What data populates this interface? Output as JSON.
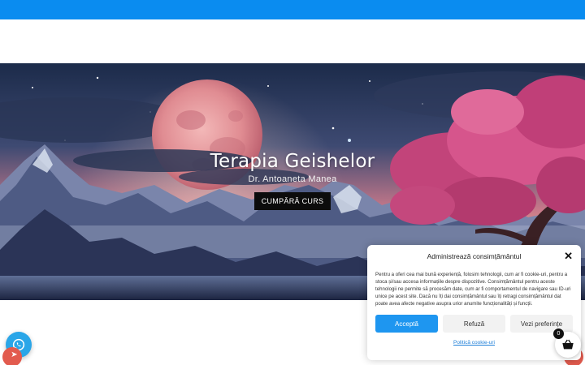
{
  "topbar": {
    "color": "#0a8cf0"
  },
  "hero": {
    "title": "Terapia Geishelor",
    "subtitle": "Dr. Antoaneta Manea",
    "button_label": "CUMPĂRĂ CURS"
  },
  "consent": {
    "title": "Administrează consimțământul",
    "body": "Pentru a oferi cea mai bună experiență, folosim tehnologii, cum ar fi cookie-uri, pentru a stoca și/sau accesa informațiile despre dispozitive. Consimțământul pentru aceste tehnologii ne permite să procesăm date, cum ar fi comportamentul de navigare sau ID-uri unice pe acest site. Dacă nu îți dai consimțământul sau îți retragi consimțământul dat poate avea afecte negative asupra urior anumite funcționalități și funcții.",
    "accept_label": "Acceptă",
    "refuse_label": "Refuză",
    "preferences_label": "Vezi preferințe",
    "policy_link": "Politică cookie-uri"
  },
  "cart": {
    "badge_count": "0"
  },
  "icons": {
    "chat": "whatsapp-icon",
    "close": "close-icon",
    "cart": "shopping-basket-icon"
  },
  "colors": {
    "accent": "#1e96f0",
    "whatsapp": "#2aa6e8",
    "scroll_red": "#e25b4e"
  }
}
